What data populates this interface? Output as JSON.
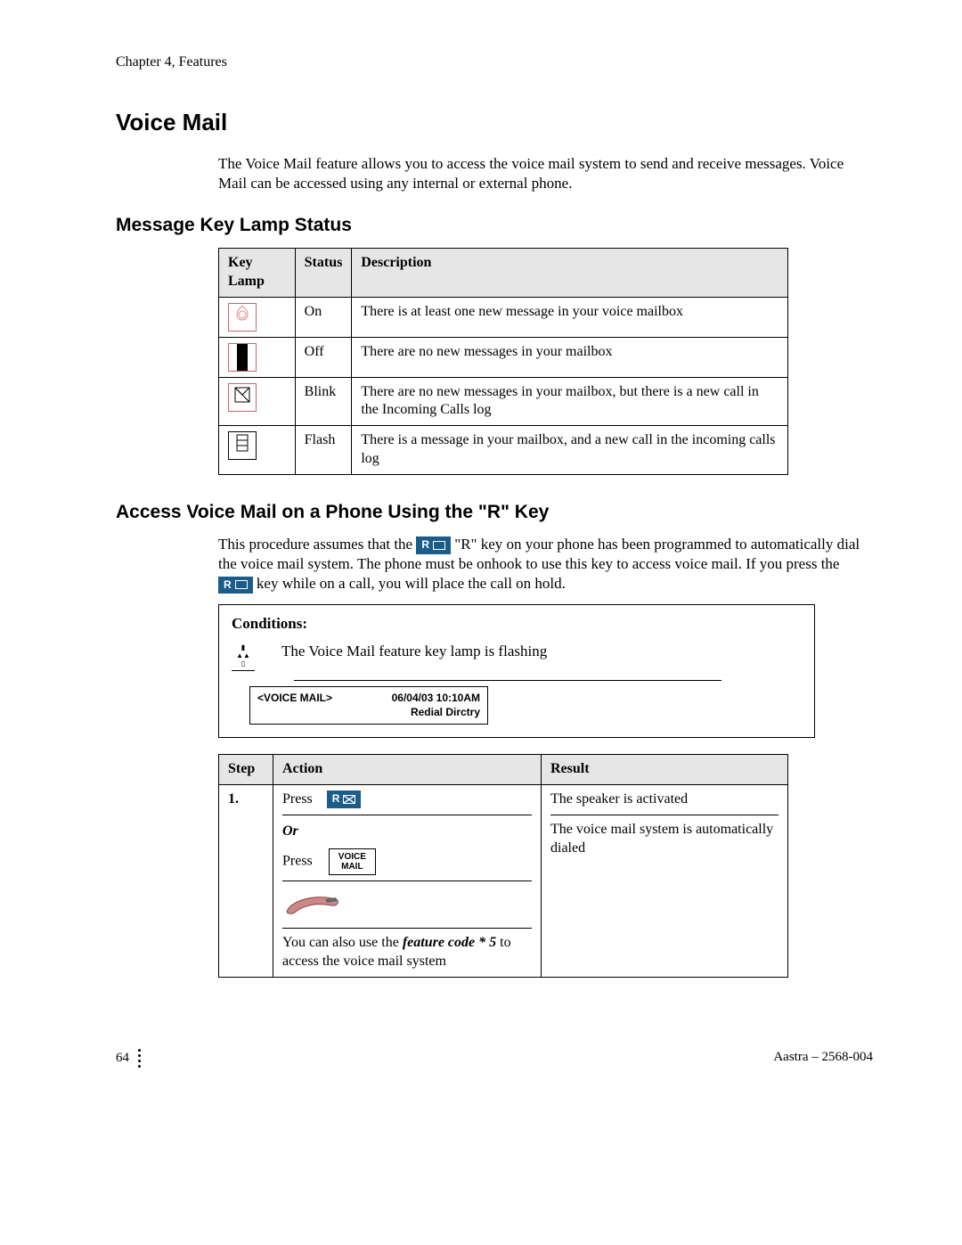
{
  "chapter": "Chapter 4, Features",
  "title": "Voice Mail",
  "intro": "The Voice Mail feature allows you to access the voice mail system to send and receive messages.  Voice Mail can be accessed using any internal or external phone.",
  "section1_title": "Message Key Lamp Status",
  "lamp_table": {
    "headers": {
      "c1": "Key Lamp",
      "c2": "Status",
      "c3": "Description"
    },
    "rows": [
      {
        "status": "On",
        "desc": "There is at least one new message in your voice mailbox"
      },
      {
        "status": "Off",
        "desc": "There are no new messages in your mailbox"
      },
      {
        "status": "Blink",
        "desc": "There are no new messages in your mailbox, but there is a new call in the Incoming Calls log"
      },
      {
        "status": "Flash",
        "desc": "There is a message in your mailbox, and a new call in the incoming calls log"
      }
    ]
  },
  "section2_title": "Access Voice Mail on a Phone Using the \"R\" Key",
  "proc_text": {
    "p1a": "This procedure assumes that the ",
    "p1b": " \"R\" key on your phone has been programmed to automatically dial the voice mail system.  The phone must be onhook to use this key to access voice mail.  If you press the ",
    "p1c": " key while on a call, you will place the call on hold."
  },
  "conditions": {
    "title": "Conditions:",
    "text": "The Voice Mail feature key lamp is flashing",
    "lcd_left": "<VOICE MAIL>",
    "lcd_right": "06/04/03 10:10AM",
    "lcd_line2": "Redial  Dirctry"
  },
  "step_table": {
    "headers": {
      "c1": "Step",
      "c2": "Action",
      "c3": "Result"
    },
    "row1": {
      "step": "1.",
      "press": "Press",
      "or": "Or",
      "press2": "Press",
      "vm_btn_l1": "VOICE",
      "vm_btn_l2": "MAIL",
      "note_a": "You can also use the ",
      "note_b": "feature code * 5",
      "note_c": " to access the voice mail system",
      "result1": "The speaker is activated",
      "result2": "The voice mail system is automatically dialed"
    }
  },
  "r_key_label": "R",
  "footer": {
    "page": "64",
    "right": "Aastra – 2568-004"
  }
}
